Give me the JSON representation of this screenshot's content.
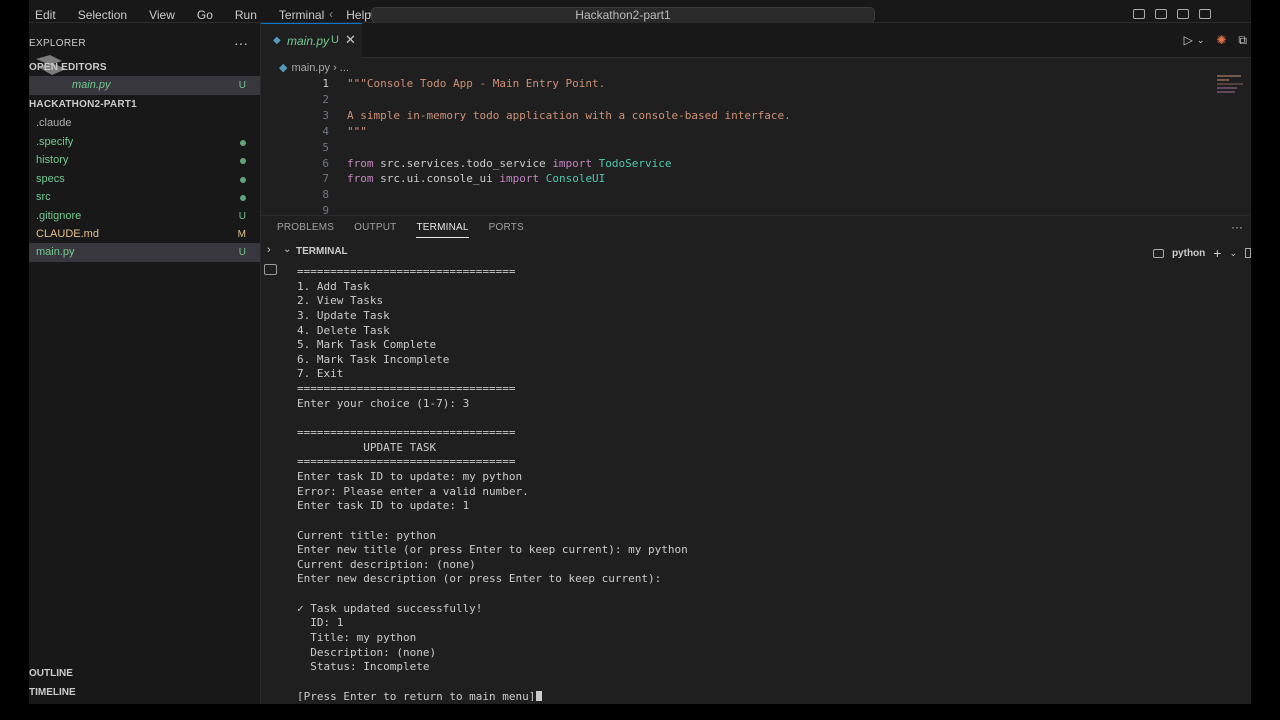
{
  "menu": [
    "Edit",
    "Selection",
    "View",
    "Go",
    "Run",
    "Terminal",
    "Help"
  ],
  "command_center": "Hackathon2-part1",
  "sidebar": {
    "header": "EXPLORER",
    "more": "···",
    "open_editors_label": "OPEN EDITORS",
    "open_editor": {
      "name": "main.py",
      "badge": "U"
    },
    "project_label": "HACKATHON2-PART1",
    "items": [
      {
        "name": ".claude",
        "status": ""
      },
      {
        "name": ".specify",
        "status": "dot"
      },
      {
        "name": "history",
        "status": "dot"
      },
      {
        "name": "specs",
        "status": "dot"
      },
      {
        "name": "src",
        "status": "dot"
      },
      {
        "name": ".gitignore",
        "status": "U"
      },
      {
        "name": "CLAUDE.md",
        "status": "M"
      },
      {
        "name": "main.py",
        "status": "U"
      }
    ],
    "outline": "OUTLINE",
    "timeline": "TIMELINE"
  },
  "editor": {
    "tab": {
      "name": "main.py",
      "badge": "U",
      "close": "✕"
    },
    "breadcrumb": {
      "file": "main.py",
      "sep": "› ..."
    },
    "lines": [
      {
        "n": "1",
        "parts": [
          {
            "t": "\"\"\"Console Todo App - Main Entry Point.",
            "c": "str"
          }
        ]
      },
      {
        "n": "2",
        "parts": []
      },
      {
        "n": "3",
        "parts": [
          {
            "t": "A simple in-memory todo application with a console-based interface.",
            "c": "str"
          }
        ]
      },
      {
        "n": "4",
        "parts": [
          {
            "t": "\"\"\"",
            "c": "str"
          }
        ]
      },
      {
        "n": "5",
        "parts": []
      },
      {
        "n": "6",
        "parts": [
          {
            "t": "from ",
            "c": "kw"
          },
          {
            "t": "src.services.todo_service ",
            "c": "mod"
          },
          {
            "t": "import ",
            "c": "kw"
          },
          {
            "t": "TodoService",
            "c": "cls"
          }
        ]
      },
      {
        "n": "7",
        "parts": [
          {
            "t": "from ",
            "c": "kw"
          },
          {
            "t": "src.ui.console_ui ",
            "c": "mod"
          },
          {
            "t": "import ",
            "c": "kw"
          },
          {
            "t": "ConsoleUI",
            "c": "cls"
          }
        ]
      },
      {
        "n": "8",
        "parts": []
      },
      {
        "n": "9",
        "parts": []
      }
    ]
  },
  "panel": {
    "tabs": [
      "PROBLEMS",
      "OUTPUT",
      "TERMINAL",
      "PORTS"
    ],
    "active_tab": "TERMINAL",
    "more": "···",
    "terminal_label": "TERMINAL",
    "shell": "python",
    "add": "+",
    "terminal_lines": [
      "=================================",
      "1. Add Task",
      "2. View Tasks",
      "3. Update Task",
      "4. Delete Task",
      "5. Mark Task Complete",
      "6. Mark Task Incomplete",
      "7. Exit",
      "=================================",
      "Enter your choice (1-7): 3",
      "",
      "=================================",
      "          UPDATE TASK",
      "=================================",
      "Enter task ID to update: my python",
      "Error: Please enter a valid number.",
      "Enter task ID to update: 1",
      "",
      "Current title: python",
      "Enter new title (or press Enter to keep current): my python",
      "Current description: (none)",
      "Enter new description (or press Enter to keep current):",
      "",
      "✓ Task updated successfully!",
      "  ID: 1",
      "  Title: my python",
      "  Description: (none)",
      "  Status: Incomplete",
      "",
      "[Press Enter to return to main menu]"
    ]
  },
  "colors": {
    "accent": "#0078d4",
    "untracked": "#73c991",
    "modified": "#e2c08d",
    "string": "#ce9178",
    "keyword": "#c586c0",
    "class": "#4ec9b0"
  }
}
